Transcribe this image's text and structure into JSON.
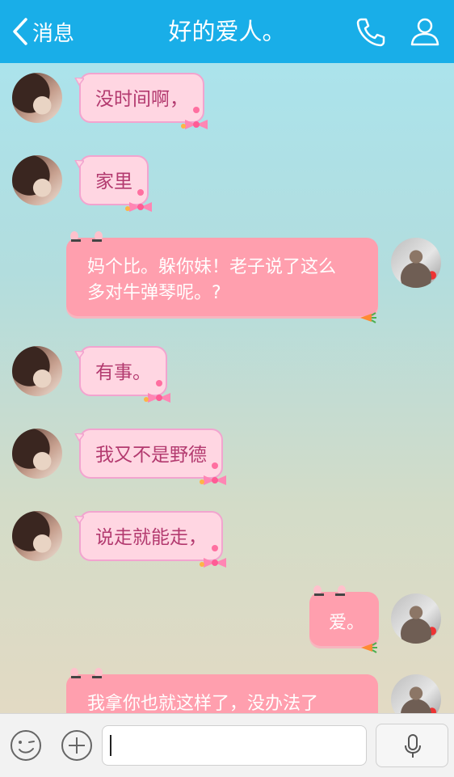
{
  "header": {
    "back_label": "消息",
    "title": "好的爱人。"
  },
  "messages": [
    {
      "side": "in",
      "text": "没时间啊，"
    },
    {
      "side": "in",
      "text": "家里"
    },
    {
      "side": "out",
      "lines": [
        "妈个比。躲你妹！老子说了这么",
        "多对牛弹琴呢。?"
      ]
    },
    {
      "side": "in",
      "text": "有事。"
    },
    {
      "side": "in",
      "text": "我又不是野德"
    },
    {
      "side": "in",
      "text": "说走就能走，"
    },
    {
      "side": "out",
      "lines": [
        "爱。"
      ]
    },
    {
      "side": "out",
      "lines": [
        "我拿你也就这样了，没办法了"
      ]
    }
  ],
  "input": {
    "value": "",
    "placeholder": ""
  },
  "colors": {
    "header": "#19aee8",
    "incoming_bubble": "#ffd6e2",
    "outgoing_bubble": "#ff9fae",
    "incoming_text": "#b33a6f"
  },
  "icons": {
    "back": "chevron-left-icon",
    "phone": "phone-icon",
    "profile": "person-icon",
    "emoji": "smiley-icon",
    "plus": "plus-icon",
    "voice": "microphone-icon"
  }
}
